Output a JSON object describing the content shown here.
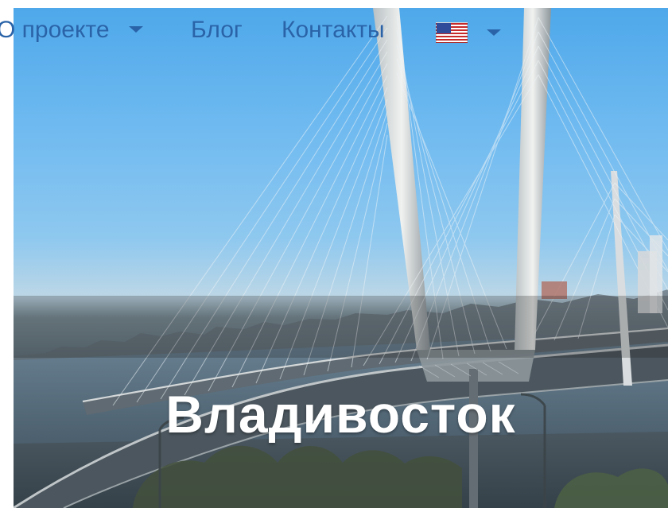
{
  "header": {
    "nav": {
      "about_label": "О проекте",
      "blog_label": "Блог",
      "contacts_label": "Контакты",
      "language_flag_icon": "us-flag-icon",
      "dropdown_icon": "chevron-down-icon"
    }
  },
  "hero": {
    "title": "Владивосток",
    "image_subject": "bridge"
  },
  "colors": {
    "nav_text": "#2a63a8",
    "sky": "#6fbaf0",
    "overlay": "#232323",
    "title": "#ffffff"
  }
}
